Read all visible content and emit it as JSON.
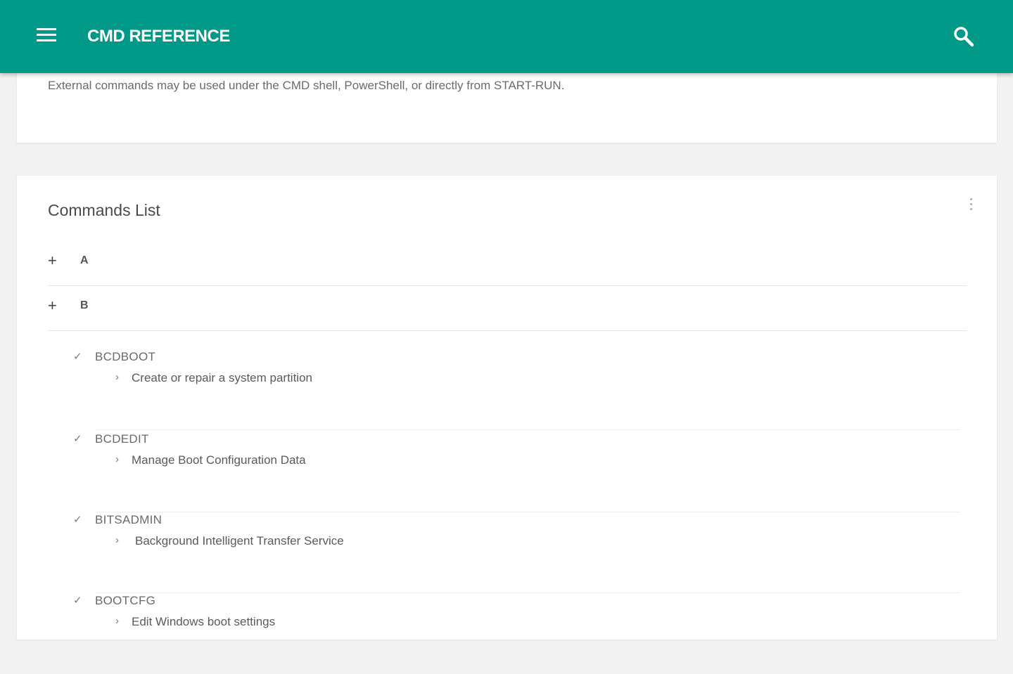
{
  "app": {
    "title": "CMD REFERENCE"
  },
  "colors": {
    "appbar": "#009886",
    "background": "#f2f2f2",
    "card": "#ffffff"
  },
  "intro": {
    "text": "External commands may be used under the CMD shell, PowerShell, or directly from START-RUN."
  },
  "commands_list": {
    "heading": "Commands List",
    "sections": [
      {
        "letter": "A",
        "expand_icon": "+"
      },
      {
        "letter": "B",
        "expand_icon": "+"
      }
    ],
    "items": [
      {
        "check_icon": "✓",
        "chevron_icon": "›",
        "name": "BCDBOOT",
        "description": "Create or repair a system partition"
      },
      {
        "check_icon": "✓",
        "chevron_icon": "›",
        "name": "BCDEDIT",
        "description": "Manage Boot Configuration Data"
      },
      {
        "check_icon": "✓",
        "chevron_icon": "›",
        "name": "BITSADMIN",
        "description": "Background Intelligent Transfer Service"
      },
      {
        "check_icon": "✓",
        "chevron_icon": "›",
        "name": "BOOTCFG",
        "description": "Edit Windows boot settings"
      }
    ]
  },
  "icons": {
    "menu": "hamburger-menu-icon",
    "search": "search-icon",
    "more": "more-vert-icon"
  }
}
